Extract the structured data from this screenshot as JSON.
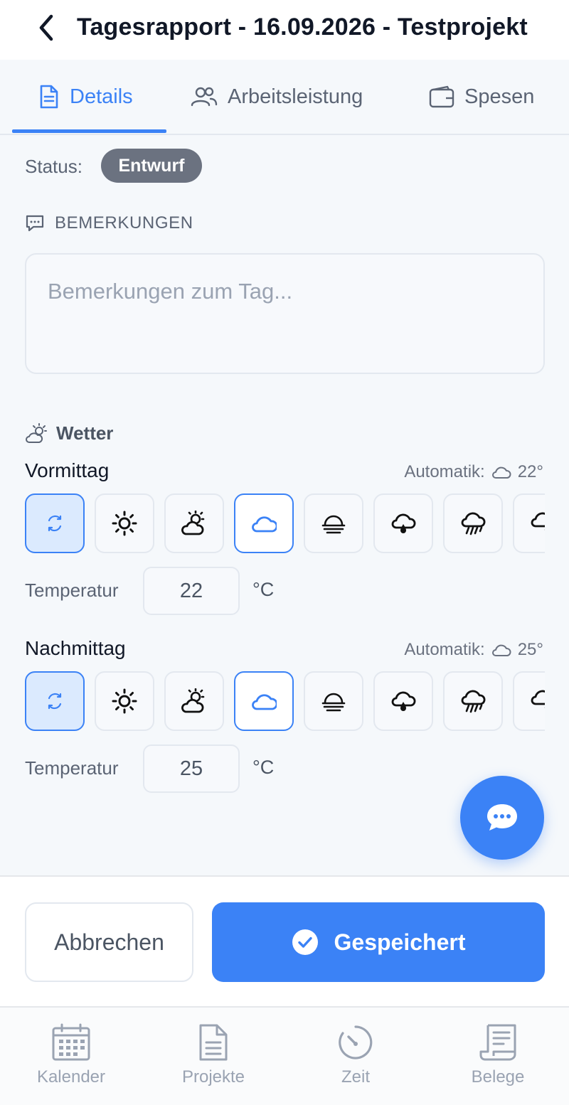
{
  "header": {
    "title": "Tagesrapport - 16.09.2026 - Testprojekt"
  },
  "tabs": [
    {
      "label": "Details",
      "icon": "document-icon",
      "active": true
    },
    {
      "label": "Arbeitsleistung",
      "icon": "users-icon",
      "active": false
    },
    {
      "label": "Spesen",
      "icon": "wallet-icon",
      "active": false
    }
  ],
  "status": {
    "label": "Status:",
    "value": "Entwurf"
  },
  "remarks": {
    "section_label": "BEMERKUNGEN",
    "placeholder": "Bemerkungen zum Tag...",
    "value": ""
  },
  "weather": {
    "title": "Wetter",
    "morning": {
      "title": "Vormittag",
      "auto_label": "Automatik:",
      "auto_temp": "22°",
      "temp_label": "Temperatur",
      "temperature": "22",
      "unit": "°C"
    },
    "afternoon": {
      "title": "Nachmittag",
      "auto_label": "Automatik:",
      "auto_temp": "25°",
      "temp_label": "Temperatur",
      "temperature": "25",
      "unit": "°C"
    },
    "options": [
      "auto-sync-icon",
      "sun-icon",
      "partly-cloudy-icon",
      "cloud-icon",
      "fog-icon",
      "rain-drop-icon",
      "heavy-rain-icon",
      "snow-icon"
    ]
  },
  "actions": {
    "cancel": "Abbrechen",
    "save": "Gespeichert"
  },
  "nav": [
    {
      "label": "Kalender",
      "icon": "calendar-icon"
    },
    {
      "label": "Projekte",
      "icon": "document-icon"
    },
    {
      "label": "Zeit",
      "icon": "clock-icon"
    },
    {
      "label": "Belege",
      "icon": "receipt-icon"
    }
  ],
  "colors": {
    "accent": "#3b82f6",
    "badge": "#6b7280",
    "background": "#f5f8fb"
  }
}
